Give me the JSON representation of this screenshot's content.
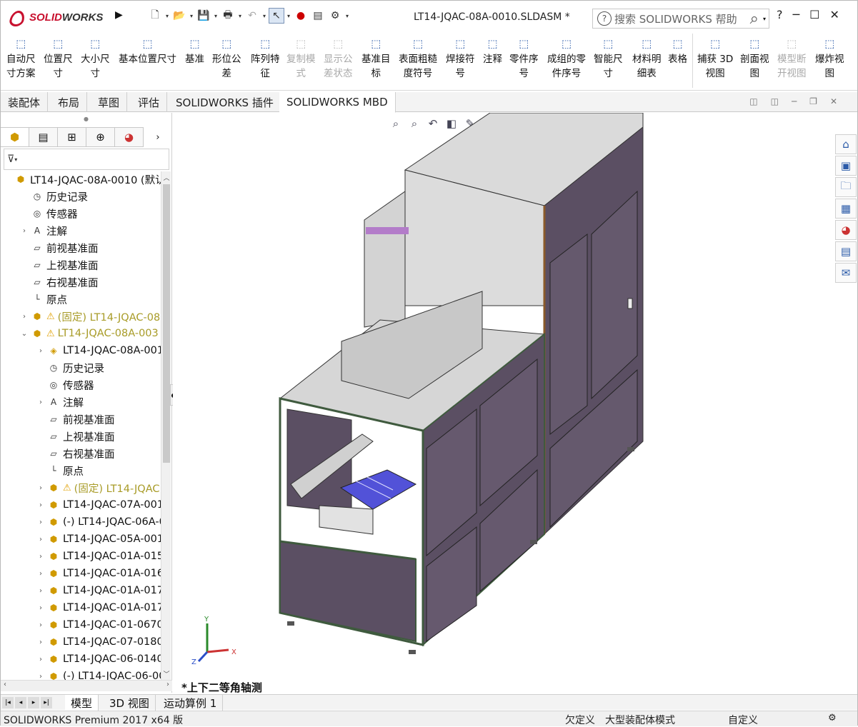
{
  "app": {
    "brand_prefix": "SOLID",
    "brand_suffix": "WORKS",
    "document_title": "LT14-JQAC-08A-0010.SLDASM *"
  },
  "search": {
    "placeholder": "搜索 SOLIDWORKS 帮助"
  },
  "window_controls": [
    "?",
    "─",
    "☐",
    "✕"
  ],
  "ribbon": [
    {
      "label": "自动尺\n寸方案",
      "icon": "auto-dimension-icon",
      "enabled": true
    },
    {
      "label": "位置尺\n寸",
      "icon": "location-dimension-icon",
      "enabled": true
    },
    {
      "label": "大小尺\n寸",
      "icon": "size-dimension-icon",
      "enabled": true
    },
    {
      "label": "基本位置尺寸",
      "icon": "basic-location-dimension-icon",
      "enabled": true
    },
    {
      "label": "基准",
      "icon": "datum-icon",
      "enabled": true
    },
    {
      "label": "形位公\n差",
      "icon": "geometric-tolerance-icon",
      "enabled": true
    },
    {
      "label": "阵列特\n征",
      "icon": "pattern-feature-icon",
      "enabled": true
    },
    {
      "label": "复制模\n式",
      "icon": "copy-scheme-icon",
      "enabled": false
    },
    {
      "label": "显示公\n差状态",
      "icon": "show-tolerance-status-icon",
      "enabled": false
    },
    {
      "label": "基准目\n标",
      "icon": "datum-target-icon",
      "enabled": true
    },
    {
      "label": "表面粗糙\n度符号",
      "icon": "surface-finish-icon",
      "enabled": true
    },
    {
      "label": "焊接符\n号",
      "icon": "weld-symbol-icon",
      "enabled": true
    },
    {
      "label": "注释",
      "icon": "note-icon",
      "enabled": true
    },
    {
      "label": "零件序\n号",
      "icon": "balloon-icon",
      "enabled": true
    },
    {
      "label": "成组的零\n件序号",
      "icon": "stacked-balloon-icon",
      "enabled": true
    },
    {
      "label": "智能尺\n寸",
      "icon": "smart-dimension-icon",
      "enabled": true
    },
    {
      "label": "材料明\n细表",
      "icon": "bom-icon",
      "enabled": true
    },
    {
      "label": "表格",
      "icon": "table-icon",
      "enabled": true
    },
    {
      "label": "捕获 3D\n视图",
      "icon": "capture-3d-view-icon",
      "enabled": true
    },
    {
      "label": "剖面视\n图",
      "icon": "section-view-icon",
      "enabled": true
    },
    {
      "label": "模型断\n开视图",
      "icon": "model-break-view-icon",
      "enabled": false
    },
    {
      "label": "爆炸视\n图",
      "icon": "exploded-view-icon",
      "enabled": true
    }
  ],
  "command_tabs": [
    "装配体",
    "布局",
    "草图",
    "评估",
    "SOLIDWORKS 插件",
    "SOLIDWORKS MBD"
  ],
  "active_command_tab": "SOLIDWORKS MBD",
  "tree": [
    {
      "text": "LT14-JQAC-08A-0010  (默认",
      "indent": 0,
      "twisty": "",
      "icon": "assembly-icon"
    },
    {
      "text": "历史记录",
      "indent": 1,
      "twisty": "",
      "icon": "history-icon"
    },
    {
      "text": "传感器",
      "indent": 1,
      "twisty": "",
      "icon": "sensor-icon"
    },
    {
      "text": "注解",
      "indent": 1,
      "twisty": "›",
      "icon": "annotation-icon"
    },
    {
      "text": "前视基准面",
      "indent": 1,
      "twisty": "",
      "icon": "plane-icon"
    },
    {
      "text": "上视基准面",
      "indent": 1,
      "twisty": "",
      "icon": "plane-icon"
    },
    {
      "text": "右视基准面",
      "indent": 1,
      "twisty": "",
      "icon": "plane-icon"
    },
    {
      "text": "原点",
      "indent": 1,
      "twisty": "",
      "icon": "origin-icon"
    },
    {
      "text": "(固定) LT14-JQAC-08",
      "indent": 1,
      "twisty": "›",
      "icon": "assembly-icon",
      "warn": true
    },
    {
      "text": "LT14-JQAC-08A-003",
      "indent": 1,
      "twisty": "⌄",
      "icon": "assembly-icon",
      "warn": true
    },
    {
      "text": "LT14-JQAC-08A-001",
      "indent": 2,
      "twisty": "›",
      "icon": "part-icon"
    },
    {
      "text": "历史记录",
      "indent": 2,
      "twisty": "",
      "icon": "history-icon"
    },
    {
      "text": "传感器",
      "indent": 2,
      "twisty": "",
      "icon": "sensor-icon"
    },
    {
      "text": "注解",
      "indent": 2,
      "twisty": "›",
      "icon": "annotation-icon"
    },
    {
      "text": "前视基准面",
      "indent": 2,
      "twisty": "",
      "icon": "plane-icon"
    },
    {
      "text": "上视基准面",
      "indent": 2,
      "twisty": "",
      "icon": "plane-icon"
    },
    {
      "text": "右视基准面",
      "indent": 2,
      "twisty": "",
      "icon": "plane-icon"
    },
    {
      "text": "原点",
      "indent": 2,
      "twisty": "",
      "icon": "origin-icon"
    },
    {
      "text": "(固定) LT14-JQAC",
      "indent": 2,
      "twisty": "›",
      "icon": "assembly-icon",
      "warn": true
    },
    {
      "text": "LT14-JQAC-07A-001",
      "indent": 2,
      "twisty": "›",
      "icon": "assembly-icon"
    },
    {
      "text": "(-) LT14-JQAC-06A-0",
      "indent": 2,
      "twisty": "›",
      "icon": "assembly-icon"
    },
    {
      "text": "LT14-JQAC-05A-001",
      "indent": 2,
      "twisty": "›",
      "icon": "assembly-icon"
    },
    {
      "text": "LT14-JQAC-01A-015",
      "indent": 2,
      "twisty": "›",
      "icon": "assembly-icon"
    },
    {
      "text": "LT14-JQAC-01A-016",
      "indent": 2,
      "twisty": "›",
      "icon": "assembly-icon"
    },
    {
      "text": "LT14-JQAC-01A-017",
      "indent": 2,
      "twisty": "›",
      "icon": "assembly-icon"
    },
    {
      "text": "LT14-JQAC-01A-017",
      "indent": 2,
      "twisty": "›",
      "icon": "assembly-icon"
    },
    {
      "text": "LT14-JQAC-01-0670",
      "indent": 2,
      "twisty": "›",
      "icon": "assembly-icon"
    },
    {
      "text": "LT14-JQAC-07-0180",
      "indent": 2,
      "twisty": "›",
      "icon": "assembly-icon"
    },
    {
      "text": "LT14-JQAC-06-0140",
      "indent": 2,
      "twisty": "›",
      "icon": "assembly-icon"
    },
    {
      "text": "(-) LT14-JQAC-06-00",
      "indent": 2,
      "twisty": "›",
      "icon": "assembly-icon"
    }
  ],
  "view_name": "*上下二等角轴测",
  "bottom_tabs": [
    "模型",
    "3D 视图",
    "运动算例 1"
  ],
  "active_bottom_tab": "模型",
  "status": {
    "product": "SOLIDWORKS Premium 2017 x64 版",
    "definition": "欠定义",
    "mode": "大型装配体模式",
    "units": "自定义"
  },
  "colors": {
    "brand_red": "#c8102e",
    "panel_fill": "#5b4f63",
    "frame_green": "#3f5a3e",
    "top_gray": "#d6d6d6",
    "tray_blue": "#5252d8",
    "accent_warning": "#a89b27"
  }
}
